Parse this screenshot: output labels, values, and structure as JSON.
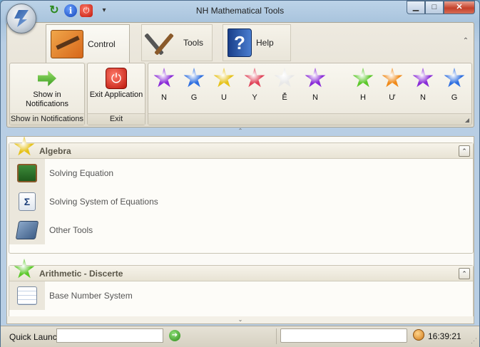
{
  "window": {
    "title": "NH Mathematical Tools",
    "controls": {
      "minimize": "▁",
      "maximize": "□",
      "close": "✕"
    }
  },
  "quick_access": {
    "info_glyph": "i",
    "power_glyph": "⏻",
    "refresh_glyph": "↻",
    "dropdown_glyph": "▾"
  },
  "ribbon": {
    "tabs": [
      {
        "label": "Control",
        "icon": "control-panel-icon",
        "active": true
      },
      {
        "label": "Tools",
        "icon": "tools-icon",
        "active": false
      },
      {
        "label": "Help",
        "icon": "help-book-icon",
        "active": false
      }
    ],
    "collapse_glyph": "⌃",
    "groups": {
      "notifications": {
        "button_label": "Show in Notifications",
        "footer": "Show in Notifications"
      },
      "exit": {
        "button_label": "Exit Application",
        "footer": "Exit"
      },
      "letters": {
        "stars": [
          {
            "letter": "N",
            "color": "#8a2bd8"
          },
          {
            "letter": "G",
            "color": "#2f6fe0"
          },
          {
            "letter": "U",
            "color": "#e6c21a"
          },
          {
            "letter": "Y",
            "color": "#e0445a"
          },
          {
            "letter": "Ễ",
            "color": "#e8e8e8"
          },
          {
            "letter": "N",
            "color": "#8a2bd8"
          },
          {
            "letter": "H",
            "color": "#5cc82a"
          },
          {
            "letter": "Ư",
            "color": "#f08a1a"
          },
          {
            "letter": "N",
            "color": "#8a2bd8"
          },
          {
            "letter": "G",
            "color": "#2f6fe0"
          }
        ]
      }
    }
  },
  "splitter_glyph": "⌃",
  "content": {
    "groups": [
      {
        "title": "Algebra",
        "star_color": "#e6c21a",
        "toggle_glyph": "⌃",
        "items": [
          {
            "label": "Solving Equation",
            "icon": "chalkboard-icon"
          },
          {
            "label": "Solving System of Equations",
            "icon": "sigma-document-icon"
          },
          {
            "label": "Other Tools",
            "icon": "calculator-icon"
          }
        ]
      },
      {
        "title": "Arithmetic - Discerte",
        "star_color": "#5cc82a",
        "toggle_glyph": "⌃",
        "items": [
          {
            "label": "Base Number System",
            "icon": "number-table-icon"
          }
        ]
      }
    ],
    "scroll_glyph": "⌄"
  },
  "statusbar": {
    "quick_launch_label": "Quick Launch",
    "quick_launch_value": "",
    "go_glyph": "➔",
    "status_value": "",
    "time": "16:39:21",
    "grip": "⋰"
  }
}
